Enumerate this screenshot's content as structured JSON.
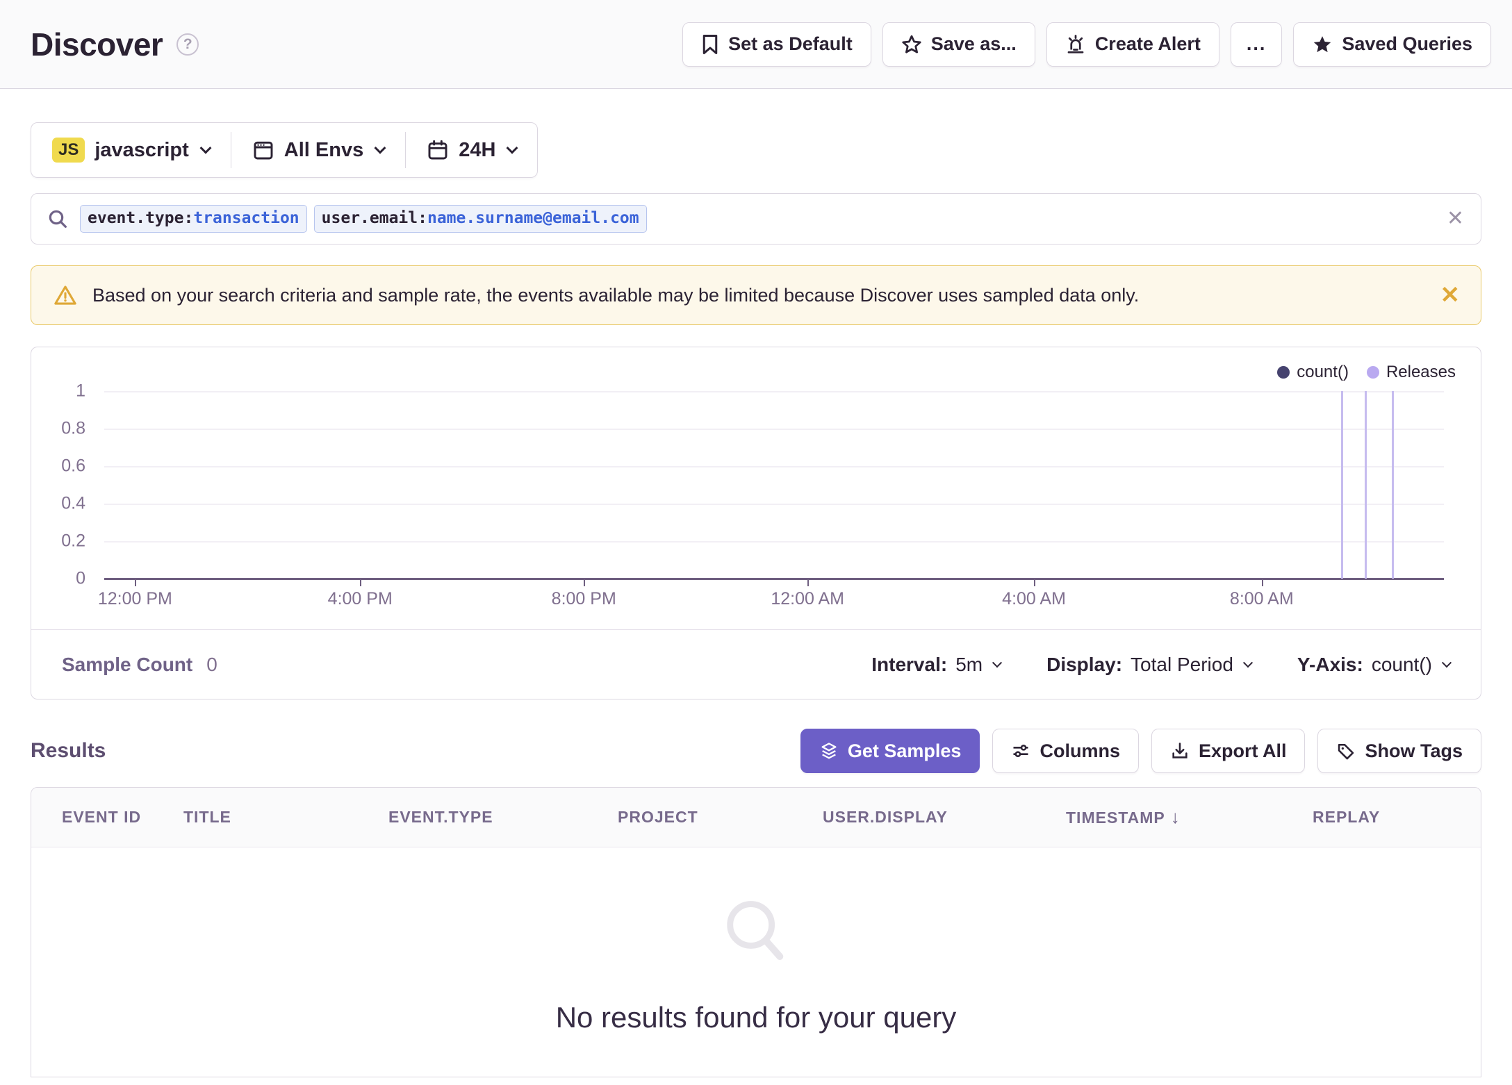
{
  "header": {
    "title": "Discover",
    "help": "?",
    "buttons": {
      "set_default": "Set as Default",
      "save_as": "Save as...",
      "create_alert": "Create Alert",
      "more": "...",
      "saved_queries": "Saved Queries"
    }
  },
  "filters": {
    "project_badge": "JS",
    "project": "javascript",
    "environment": "All Envs",
    "time_range": "24H"
  },
  "search": {
    "tokens": [
      {
        "key": "event.type:",
        "value": "transaction"
      },
      {
        "key": "user.email:",
        "value": "name.surname@email.com"
      }
    ]
  },
  "banner": {
    "message": "Based on your search criteria and sample rate, the events available may be limited because Discover uses sampled data only."
  },
  "chart_data": {
    "type": "line",
    "title": "",
    "xlabel": "",
    "ylabel": "",
    "ylim": [
      0,
      1
    ],
    "grid": true,
    "legend_position": "top-right",
    "legend": [
      {
        "name": "count()",
        "color": "#46436F"
      },
      {
        "name": "Releases",
        "color": "#B9A9F0"
      }
    ],
    "series": [
      {
        "name": "count()",
        "values": [],
        "note": "no data points rendered; query returned 0 samples"
      }
    ],
    "y_tick_labels": [
      "1",
      "0.8",
      "0.6",
      "0.4",
      "0.2",
      "0"
    ],
    "x_tick_labels": [
      "12:00 PM",
      "4:00 PM",
      "8:00 PM",
      "12:00 AM",
      "4:00 AM",
      "8:00 AM"
    ],
    "x_tick_pct": [
      2.3,
      19.1,
      35.8,
      52.5,
      69.4,
      86.4
    ],
    "release_lines_pct": [
      92.3,
      94.1,
      96.1
    ],
    "colors": {
      "axis": "#6F5F80",
      "release_line": "#C6BCEF"
    }
  },
  "chart_footer": {
    "sample_count_label": "Sample Count",
    "sample_count_value": "0",
    "interval_label": "Interval:",
    "interval_value": "5m",
    "display_label": "Display:",
    "display_value": "Total Period",
    "yaxis_label": "Y-Axis:",
    "yaxis_value": "count()"
  },
  "results": {
    "heading": "Results",
    "buttons": {
      "get_samples": "Get Samples",
      "columns": "Columns",
      "export_all": "Export All",
      "show_tags": "Show Tags"
    },
    "table": {
      "headers": [
        "EVENT ID",
        "TITLE",
        "EVENT.TYPE",
        "PROJECT",
        "USER.DISPLAY",
        "TIMESTAMP",
        "REPLAY"
      ],
      "sort_column": "TIMESTAMP",
      "sort_icon": "↓",
      "rows": []
    },
    "empty_message": "No results found for your query"
  },
  "colors": {
    "accent_purple": "#6C5FC7",
    "warning_yellow": "#DFA837",
    "js_badge_yellow": "#F0DA4E",
    "token_value_blue": "#3B63D8"
  }
}
